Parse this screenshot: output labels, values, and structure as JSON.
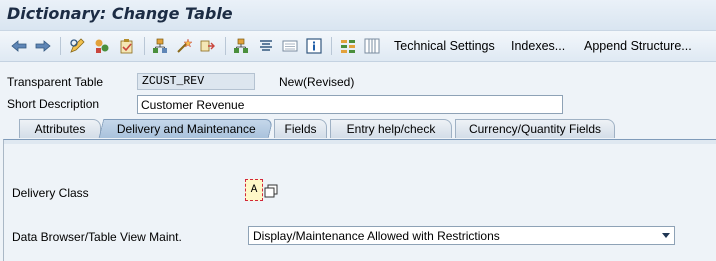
{
  "window": {
    "title": "Dictionary: Change Table"
  },
  "toolbar": {
    "icons": [
      "back-arrow-icon",
      "forward-arrow-icon",
      "display-change-icon",
      "other-object-icon",
      "check-icon",
      "activate-icon",
      "where-used-icon",
      "object-list-icon",
      "navigation-icon",
      "hierarchy-icon",
      "display-object-list-icon",
      "info-icon",
      "contents-icon",
      "layout-icon"
    ],
    "buttons": {
      "technical_settings": "Technical Settings",
      "indexes": "Indexes...",
      "append_structure": "Append Structure..."
    }
  },
  "header": {
    "table_label": "Transparent Table",
    "table_value": "ZCUST_REV",
    "table_status": "New(Revised)",
    "short_desc_label": "Short Description",
    "short_desc_value": "Customer Revenue"
  },
  "tabs": [
    {
      "label": "Attributes",
      "active": false
    },
    {
      "label": "Delivery and Maintenance",
      "active": true
    },
    {
      "label": "Fields",
      "active": false
    },
    {
      "label": "Entry help/check",
      "active": false
    },
    {
      "label": "Currency/Quantity Fields",
      "active": false
    }
  ],
  "delivery": {
    "class_label": "Delivery Class",
    "class_value": "A",
    "browser_label": "Data Browser/Table View Maint.",
    "browser_value": "Display/Maintenance Allowed with Restrictions"
  },
  "colors": {
    "accent": "#7f9bba",
    "title": "#1c2c44",
    "f4_border": "#d2273a"
  }
}
